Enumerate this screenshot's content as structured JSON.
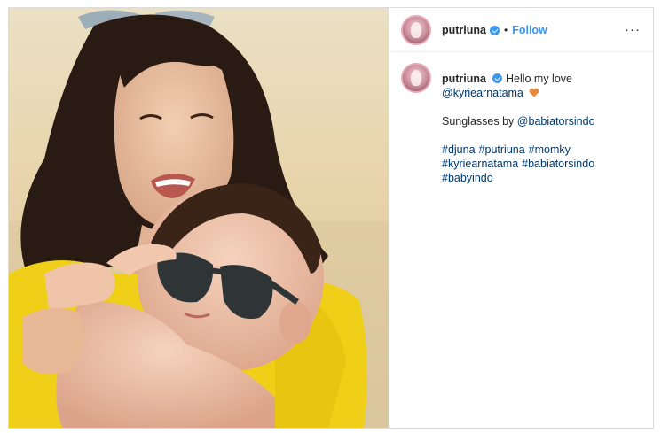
{
  "post": {
    "username": "putriuna",
    "follow_label": "Follow",
    "separator": "•",
    "more_label": "···"
  },
  "caption": {
    "username": "putriuna",
    "greeting": "Hello my love",
    "mention": "@kyriearnatama",
    "sunglasses_text": "Sunglasses by",
    "sunglasses_mention": "@babiatorsindo",
    "hashtags": [
      "#djuna",
      "#putriuna",
      "#momky",
      "#kyriearnatama",
      "#babiatorsindo",
      "#babyindo"
    ]
  },
  "icons": {
    "verified": "verified-badge-icon",
    "heart": "orange-heart-icon",
    "more": "more-options-icon"
  },
  "colors": {
    "accent": "#3897f0",
    "link": "#00376b",
    "heart": "#e7893d",
    "dress": "#f0d51c"
  }
}
